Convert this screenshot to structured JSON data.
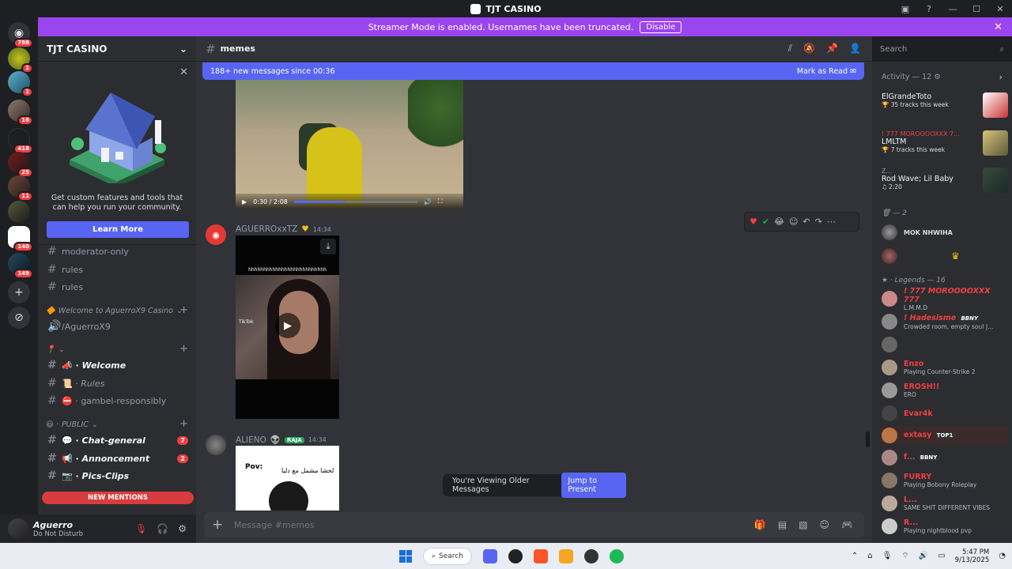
{
  "window": {
    "title": "TJT CASINO"
  },
  "banner": {
    "text": "Streamer Mode is enabled. Usernames have been truncated.",
    "disable_label": "Disable"
  },
  "guilds": {
    "badges": [
      "788",
      "1",
      "1",
      "16",
      "418",
      "25",
      "11",
      "140",
      "149"
    ]
  },
  "server": {
    "name": "TJT CASINO"
  },
  "promo": {
    "text": "Get custom features and tools that can help you run your community.",
    "button": "Learn More"
  },
  "channels": {
    "top": [
      "moderator-only",
      "rules",
      "rules"
    ],
    "category1": "Welcome to AguerroX9 Casino",
    "voice": "/AguerroX9",
    "welcome": "Welcome",
    "rules2": "Rules",
    "gamble": "gambel-responsibly",
    "category_public": "PUBLIC",
    "chat_general": "Chat-general",
    "chat_general_count": "7",
    "annoncement": "Annoncement",
    "annoncement_count": "2",
    "pics_clips": "Pics-Clips"
  },
  "new_mentions": "NEW MENTIONS",
  "user": {
    "name": "Aguerro",
    "status": "Do Not Disturb"
  },
  "channel": {
    "name": "memes"
  },
  "newmsg": {
    "text": "188+ new messages since 00:36",
    "mark_read": "Mark as Read"
  },
  "video1": {
    "time": "0:30 / 2:08",
    "progress": 0.42
  },
  "messages": [
    {
      "author": "AGUERROxxTZ",
      "time": "14:34"
    },
    {
      "author": "ALIENO",
      "tag": "RAJA",
      "time": "14:34"
    }
  ],
  "video2": {
    "caption": "hhhhhhhhhhhhhhhhhhhhhhhhhh",
    "tiktok": "TikTok"
  },
  "video3": {
    "pov": "Pov:",
    "arabic": "لخشا مشمل مع دليا"
  },
  "older": {
    "text": "You're Viewing Older Messages",
    "jump": "Jump to Present"
  },
  "composer": {
    "placeholder": "Message #memes"
  },
  "search": {
    "placeholder": "Search"
  },
  "activity": {
    "header": "Activity — 12",
    "items": [
      {
        "small": "",
        "title": "ElGrandeToto",
        "sub": "35 tracks this week"
      },
      {
        "small": "! 777 MOROOOOXXX 7...",
        "title": "LMLTM",
        "sub": "7 tracks this week"
      },
      {
        "small": "Z...",
        "title": "Rod Wave; Lil Baby",
        "sub": "2:20"
      }
    ]
  },
  "group_two": "— 2",
  "members_top": [
    {
      "name": "MOK NHWIHA",
      "status": ""
    }
  ],
  "legends_header": "Legends — 16",
  "legends": [
    {
      "name": "! 777 MOROOOOXXX 777",
      "status": "L.M.M.D",
      "color": "#f23f43"
    },
    {
      "name": "! Hadesisme",
      "tag": "BBNY",
      "status": "Crowded room, empty soul |...",
      "color": "#f23f43"
    },
    {
      "name": "",
      "status": "",
      "color": "#f23f43"
    },
    {
      "name": "Enzo",
      "status": "Playing Counter-Strike 2",
      "color": "#f23f43"
    },
    {
      "name": "EROSH!!",
      "status": "ERO",
      "color": "#f23f43"
    },
    {
      "name": "Evar4k",
      "status": "",
      "color": "#f23f43"
    },
    {
      "name": "extasy",
      "tag": "TOP1",
      "status": "",
      "color": "#f23f43"
    },
    {
      "name": "f...",
      "tag": "BBNY",
      "status": "",
      "color": "#f23f43"
    },
    {
      "name": "FURRY",
      "status": "Playing Bobony Roleplay",
      "color": "#f23f43"
    },
    {
      "name": "L...",
      "status": "SAME SHIT DIFFERENT VIBES",
      "color": "#f23f43"
    },
    {
      "name": "R...",
      "status": "Playing nightblood pvp",
      "color": "#f23f43"
    }
  ],
  "taskbar": {
    "search": "Search",
    "time": "5:47 PM",
    "date": "9/13/2025"
  }
}
